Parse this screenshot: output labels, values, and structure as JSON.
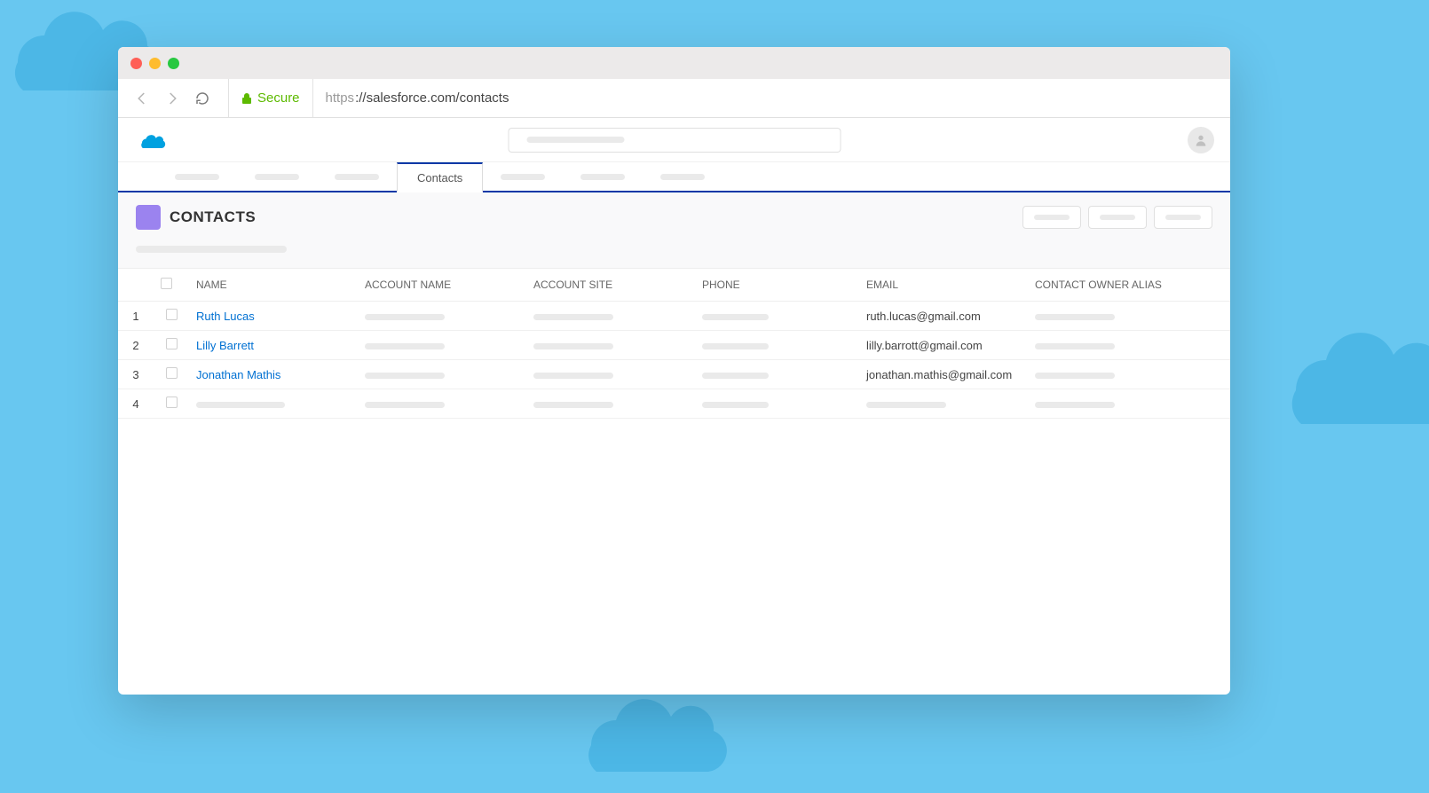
{
  "browser": {
    "secure_label": "Secure",
    "url_scheme": "https",
    "url_rest": "://salesforce.com/contacts"
  },
  "tabs": {
    "active_label": "Contacts"
  },
  "page": {
    "title": "CONTACTS"
  },
  "table": {
    "headers": {
      "name": "NAME",
      "account_name": "ACCOUNT NAME",
      "account_site": "ACCOUNT SITE",
      "phone": "PHONE",
      "email": "EMAIL",
      "owner": "CONTACT OWNER ALIAS"
    },
    "rows": [
      {
        "num": "1",
        "name": "Ruth Lucas",
        "email": "ruth.lucas@gmail.com"
      },
      {
        "num": "2",
        "name": "Lilly Barrett",
        "email": "lilly.barrott@gmail.com"
      },
      {
        "num": "3",
        "name": "Jonathan Mathis",
        "email": "jonathan.mathis@gmail.com"
      },
      {
        "num": "4",
        "name": "",
        "email": ""
      }
    ]
  }
}
